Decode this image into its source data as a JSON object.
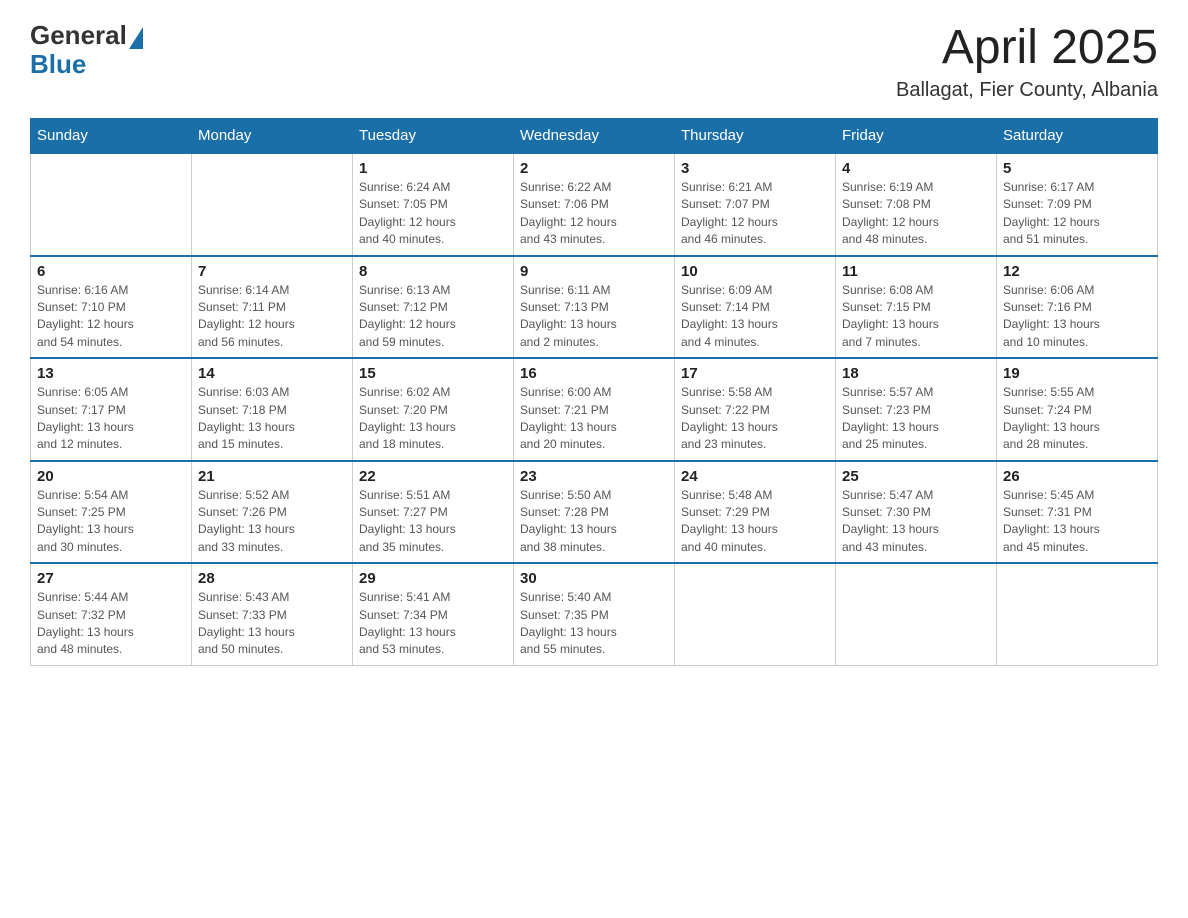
{
  "header": {
    "logo_general": "General",
    "logo_blue": "Blue",
    "month_title": "April 2025",
    "location": "Ballagat, Fier County, Albania"
  },
  "days_of_week": [
    "Sunday",
    "Monday",
    "Tuesday",
    "Wednesday",
    "Thursday",
    "Friday",
    "Saturday"
  ],
  "weeks": [
    [
      {
        "day": "",
        "info": ""
      },
      {
        "day": "",
        "info": ""
      },
      {
        "day": "1",
        "info": "Sunrise: 6:24 AM\nSunset: 7:05 PM\nDaylight: 12 hours\nand 40 minutes."
      },
      {
        "day": "2",
        "info": "Sunrise: 6:22 AM\nSunset: 7:06 PM\nDaylight: 12 hours\nand 43 minutes."
      },
      {
        "day": "3",
        "info": "Sunrise: 6:21 AM\nSunset: 7:07 PM\nDaylight: 12 hours\nand 46 minutes."
      },
      {
        "day": "4",
        "info": "Sunrise: 6:19 AM\nSunset: 7:08 PM\nDaylight: 12 hours\nand 48 minutes."
      },
      {
        "day": "5",
        "info": "Sunrise: 6:17 AM\nSunset: 7:09 PM\nDaylight: 12 hours\nand 51 minutes."
      }
    ],
    [
      {
        "day": "6",
        "info": "Sunrise: 6:16 AM\nSunset: 7:10 PM\nDaylight: 12 hours\nand 54 minutes."
      },
      {
        "day": "7",
        "info": "Sunrise: 6:14 AM\nSunset: 7:11 PM\nDaylight: 12 hours\nand 56 minutes."
      },
      {
        "day": "8",
        "info": "Sunrise: 6:13 AM\nSunset: 7:12 PM\nDaylight: 12 hours\nand 59 minutes."
      },
      {
        "day": "9",
        "info": "Sunrise: 6:11 AM\nSunset: 7:13 PM\nDaylight: 13 hours\nand 2 minutes."
      },
      {
        "day": "10",
        "info": "Sunrise: 6:09 AM\nSunset: 7:14 PM\nDaylight: 13 hours\nand 4 minutes."
      },
      {
        "day": "11",
        "info": "Sunrise: 6:08 AM\nSunset: 7:15 PM\nDaylight: 13 hours\nand 7 minutes."
      },
      {
        "day": "12",
        "info": "Sunrise: 6:06 AM\nSunset: 7:16 PM\nDaylight: 13 hours\nand 10 minutes."
      }
    ],
    [
      {
        "day": "13",
        "info": "Sunrise: 6:05 AM\nSunset: 7:17 PM\nDaylight: 13 hours\nand 12 minutes."
      },
      {
        "day": "14",
        "info": "Sunrise: 6:03 AM\nSunset: 7:18 PM\nDaylight: 13 hours\nand 15 minutes."
      },
      {
        "day": "15",
        "info": "Sunrise: 6:02 AM\nSunset: 7:20 PM\nDaylight: 13 hours\nand 18 minutes."
      },
      {
        "day": "16",
        "info": "Sunrise: 6:00 AM\nSunset: 7:21 PM\nDaylight: 13 hours\nand 20 minutes."
      },
      {
        "day": "17",
        "info": "Sunrise: 5:58 AM\nSunset: 7:22 PM\nDaylight: 13 hours\nand 23 minutes."
      },
      {
        "day": "18",
        "info": "Sunrise: 5:57 AM\nSunset: 7:23 PM\nDaylight: 13 hours\nand 25 minutes."
      },
      {
        "day": "19",
        "info": "Sunrise: 5:55 AM\nSunset: 7:24 PM\nDaylight: 13 hours\nand 28 minutes."
      }
    ],
    [
      {
        "day": "20",
        "info": "Sunrise: 5:54 AM\nSunset: 7:25 PM\nDaylight: 13 hours\nand 30 minutes."
      },
      {
        "day": "21",
        "info": "Sunrise: 5:52 AM\nSunset: 7:26 PM\nDaylight: 13 hours\nand 33 minutes."
      },
      {
        "day": "22",
        "info": "Sunrise: 5:51 AM\nSunset: 7:27 PM\nDaylight: 13 hours\nand 35 minutes."
      },
      {
        "day": "23",
        "info": "Sunrise: 5:50 AM\nSunset: 7:28 PM\nDaylight: 13 hours\nand 38 minutes."
      },
      {
        "day": "24",
        "info": "Sunrise: 5:48 AM\nSunset: 7:29 PM\nDaylight: 13 hours\nand 40 minutes."
      },
      {
        "day": "25",
        "info": "Sunrise: 5:47 AM\nSunset: 7:30 PM\nDaylight: 13 hours\nand 43 minutes."
      },
      {
        "day": "26",
        "info": "Sunrise: 5:45 AM\nSunset: 7:31 PM\nDaylight: 13 hours\nand 45 minutes."
      }
    ],
    [
      {
        "day": "27",
        "info": "Sunrise: 5:44 AM\nSunset: 7:32 PM\nDaylight: 13 hours\nand 48 minutes."
      },
      {
        "day": "28",
        "info": "Sunrise: 5:43 AM\nSunset: 7:33 PM\nDaylight: 13 hours\nand 50 minutes."
      },
      {
        "day": "29",
        "info": "Sunrise: 5:41 AM\nSunset: 7:34 PM\nDaylight: 13 hours\nand 53 minutes."
      },
      {
        "day": "30",
        "info": "Sunrise: 5:40 AM\nSunset: 7:35 PM\nDaylight: 13 hours\nand 55 minutes."
      },
      {
        "day": "",
        "info": ""
      },
      {
        "day": "",
        "info": ""
      },
      {
        "day": "",
        "info": ""
      }
    ]
  ]
}
